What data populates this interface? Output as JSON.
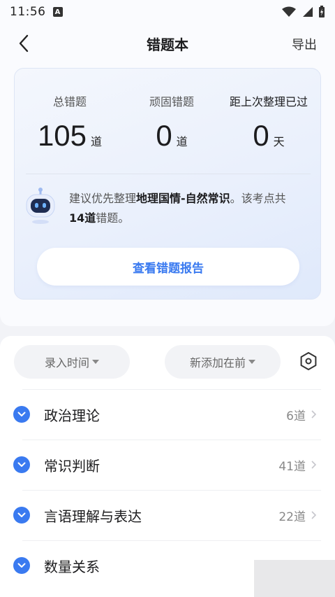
{
  "status": {
    "time": "11:56",
    "a_icon": "A"
  },
  "nav": {
    "title": "错题本",
    "export_label": "导出"
  },
  "summary": {
    "total_label": "总错题",
    "total_value": "105",
    "total_unit": "道",
    "review_label": "顽固错题",
    "review_value": "0",
    "review_unit": "道",
    "last_label": "距上次整理已过",
    "last_value": "0",
    "last_unit": "天",
    "tip_prefix": "建议优先整理",
    "tip_topic": "地理国情-自然常识",
    "tip_mid": "。该考点共",
    "tip_count": "14道",
    "tip_suffix": "错题。",
    "report_button": "查看错题报告"
  },
  "filters": {
    "time_label": "录入时间",
    "order_label": "新添加在前"
  },
  "categories": [
    {
      "name": "政治理论",
      "count": "6道"
    },
    {
      "name": "常识判断",
      "count": "41道"
    },
    {
      "name": "言语理解与表达",
      "count": "22道"
    },
    {
      "name": "数量关系",
      "count": ""
    }
  ],
  "colors": {
    "accent": "#3a7af0",
    "page_bg": "#f2f3f7"
  }
}
